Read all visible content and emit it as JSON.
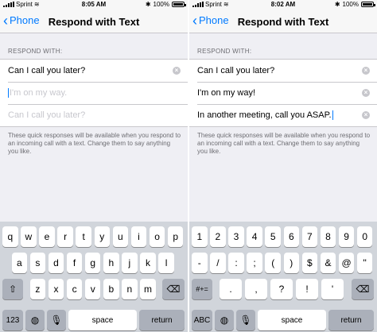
{
  "screens": [
    {
      "status": {
        "carrier": "Sprint",
        "time": "8:05 AM",
        "battery": "100%"
      },
      "nav": {
        "back_label": "Phone",
        "title": "Respond with Text"
      },
      "section_header": "RESPOND WITH:",
      "rows": [
        {
          "value": "Can I call you later?",
          "placeholder": ""
        },
        {
          "value": "",
          "placeholder": "I'm on my way."
        },
        {
          "value": "",
          "placeholder": "Can I call you later?"
        }
      ],
      "footer": "These quick responses will be available when you respond to an incoming call with a text. Change them to say anything you like.",
      "keyboard": {
        "row1": [
          "q",
          "w",
          "e",
          "r",
          "t",
          "y",
          "u",
          "i",
          "o",
          "p"
        ],
        "row2": [
          "a",
          "s",
          "d",
          "f",
          "g",
          "h",
          "j",
          "k",
          "l"
        ],
        "row3": [
          "z",
          "x",
          "c",
          "v",
          "b",
          "n",
          "m"
        ],
        "mode_key": "123",
        "space": "space",
        "return": "return"
      }
    },
    {
      "status": {
        "carrier": "Sprint",
        "time": "8:02 AM",
        "battery": "100%"
      },
      "nav": {
        "back_label": "Phone",
        "title": "Respond with Text"
      },
      "section_header": "RESPOND WITH:",
      "rows": [
        {
          "value": "Can I call you later?",
          "placeholder": ""
        },
        {
          "value": "I'm on my way!",
          "placeholder": ""
        },
        {
          "value": "In another meeting, call you ASAP.",
          "placeholder": ""
        }
      ],
      "footer": "These quick responses will be available when you respond to an incoming call with a text. Change them to say anything you like.",
      "keyboard": {
        "row1": [
          "1",
          "2",
          "3",
          "4",
          "5",
          "6",
          "7",
          "8",
          "9",
          "0"
        ],
        "row2": [
          "-",
          "/",
          ":",
          ";",
          "(",
          ")",
          "$",
          "&",
          "@",
          "\""
        ],
        "row3": [
          ".",
          ",",
          "?",
          "!",
          "'"
        ],
        "shift_key": "#+=",
        "mode_key": "ABC",
        "space": "space",
        "return": "return"
      }
    }
  ],
  "icons": {
    "back": "chevron-left-icon",
    "clear": "clear-x-icon",
    "shift": "shift-arrow-icon",
    "delete": "delete-backspace-icon",
    "globe": "globe-icon",
    "mic": "microphone-icon",
    "wifi": "wifi-icon",
    "bluetooth": "bluetooth-icon"
  },
  "colors": {
    "accent": "#007aff",
    "background": "#efeff4",
    "keyboard": "#d1d5db"
  }
}
